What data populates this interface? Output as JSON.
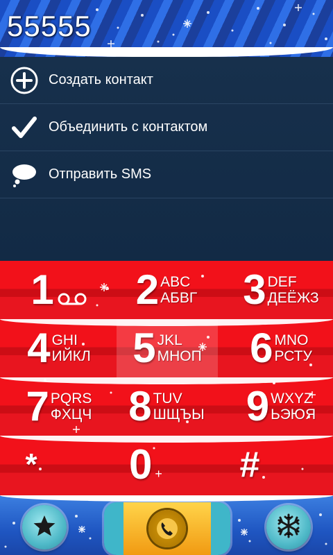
{
  "dialer": {
    "number": "55555"
  },
  "menu": {
    "items": [
      {
        "label": "Создать контакт",
        "icon": "add-circle-icon"
      },
      {
        "label": "Объединить с контактом",
        "icon": "checkmark-icon"
      },
      {
        "label": "Отправить SMS",
        "icon": "speech-bubble-icon"
      }
    ]
  },
  "keypad": {
    "keys": [
      {
        "digit": "1",
        "latin": "",
        "cyrillic": "",
        "icon": "voicemail-icon"
      },
      {
        "digit": "2",
        "latin": "ABC",
        "cyrillic": "АБВГ"
      },
      {
        "digit": "3",
        "latin": "DEF",
        "cyrillic": "ДЕЁЖЗ"
      },
      {
        "digit": "4",
        "latin": "GHI",
        "cyrillic": "ИЙКЛ"
      },
      {
        "digit": "5",
        "latin": "JKL",
        "cyrillic": "МНОП"
      },
      {
        "digit": "6",
        "latin": "MNO",
        "cyrillic": "РСТУ"
      },
      {
        "digit": "7",
        "latin": "PQRS",
        "cyrillic": "ФХЦЧ"
      },
      {
        "digit": "8",
        "latin": "TUV",
        "cyrillic": "ШЩЪЫ"
      },
      {
        "digit": "9",
        "latin": "WXYZ",
        "cyrillic": "ЬЭЮЯ"
      },
      {
        "digit": "*",
        "latin": "",
        "cyrillic": ""
      },
      {
        "digit": "0",
        "latin": "+",
        "cyrillic": ""
      },
      {
        "digit": "#",
        "latin": "",
        "cyrillic": ""
      }
    ]
  },
  "bottombar": {
    "favorites_icon": "star-icon",
    "call_icon": "phone-handset-icon",
    "settings_icon": "snowflake-icon"
  },
  "colors": {
    "header_blue": "#2f6fe6",
    "menu_bg": "#142c47",
    "keypad_red": "#f2111a",
    "call_orange": "#f6b21e",
    "button_teal": "#4fb9c8"
  }
}
